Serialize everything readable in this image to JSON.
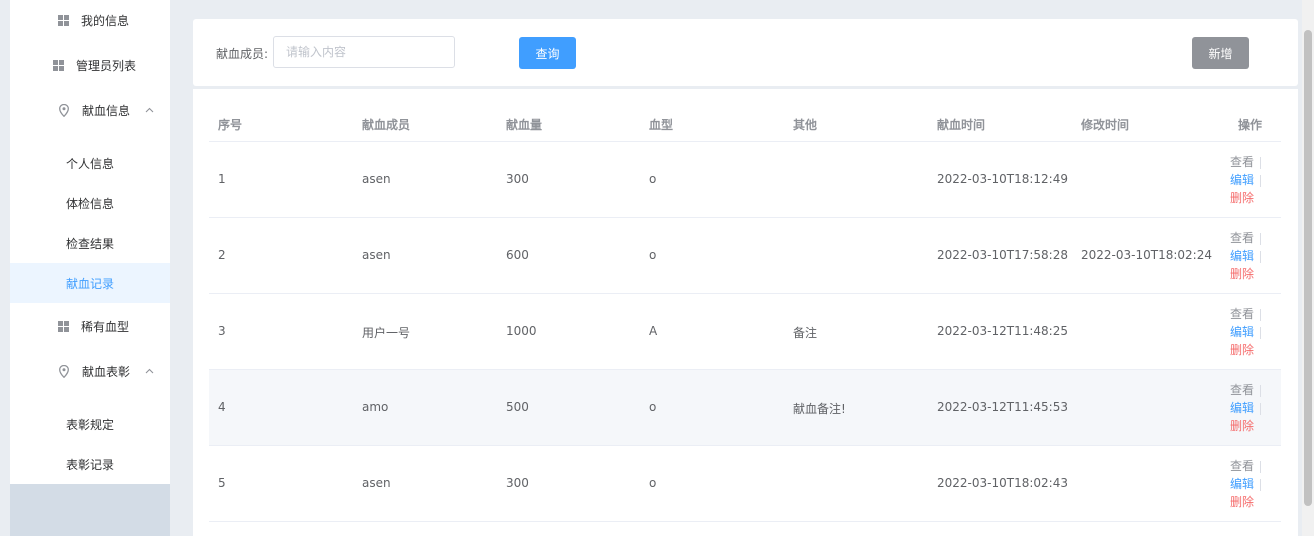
{
  "sidebar": {
    "items": [
      {
        "label": "我的信息",
        "icon": "grid-icon"
      },
      {
        "label": "管理员列表",
        "icon": "grid-icon"
      },
      {
        "label": "献血信息",
        "icon": "location-pin-icon"
      },
      {
        "label": "稀有血型",
        "icon": "grid-icon"
      },
      {
        "label": "献血表彰",
        "icon": "location-pin-icon"
      }
    ],
    "blood_sub": [
      "个人信息",
      "体检信息",
      "检查结果",
      "献血记录"
    ],
    "award_sub": [
      "表彰规定",
      "表彰记录"
    ]
  },
  "search": {
    "label": "献血成员:",
    "placeholder": "请输入内容",
    "value": "",
    "query_label": "查询",
    "add_label": "新增"
  },
  "table": {
    "headers": [
      "序号",
      "献血成员",
      "献血量",
      "血型",
      "其他",
      "献血时间",
      "修改时间",
      "操作"
    ],
    "rows": [
      {
        "id": "1",
        "member": "asen",
        "amount": "300",
        "type": "o",
        "other": "",
        "time": "2022-03-10T18:12:49",
        "modified": ""
      },
      {
        "id": "2",
        "member": "asen",
        "amount": "600",
        "type": "o",
        "other": "",
        "time": "2022-03-10T17:58:28",
        "modified": "2022-03-10T18:02:24"
      },
      {
        "id": "3",
        "member": "用户一号",
        "amount": "1000",
        "type": "A",
        "other": "备注",
        "time": "2022-03-12T11:48:25",
        "modified": ""
      },
      {
        "id": "4",
        "member": "amo",
        "amount": "500",
        "type": "o",
        "other": "献血备注!",
        "time": "2022-03-12T11:45:53",
        "modified": ""
      },
      {
        "id": "5",
        "member": "asen",
        "amount": "300",
        "type": "o",
        "other": "",
        "time": "2022-03-10T18:02:43",
        "modified": ""
      }
    ],
    "ops": {
      "view": "查看",
      "edit": "编辑",
      "delete": "删除"
    }
  },
  "colors": {
    "primary": "#409eff",
    "danger": "#f56c6c",
    "info": "#909399",
    "active_bg": "#ecf5ff"
  }
}
